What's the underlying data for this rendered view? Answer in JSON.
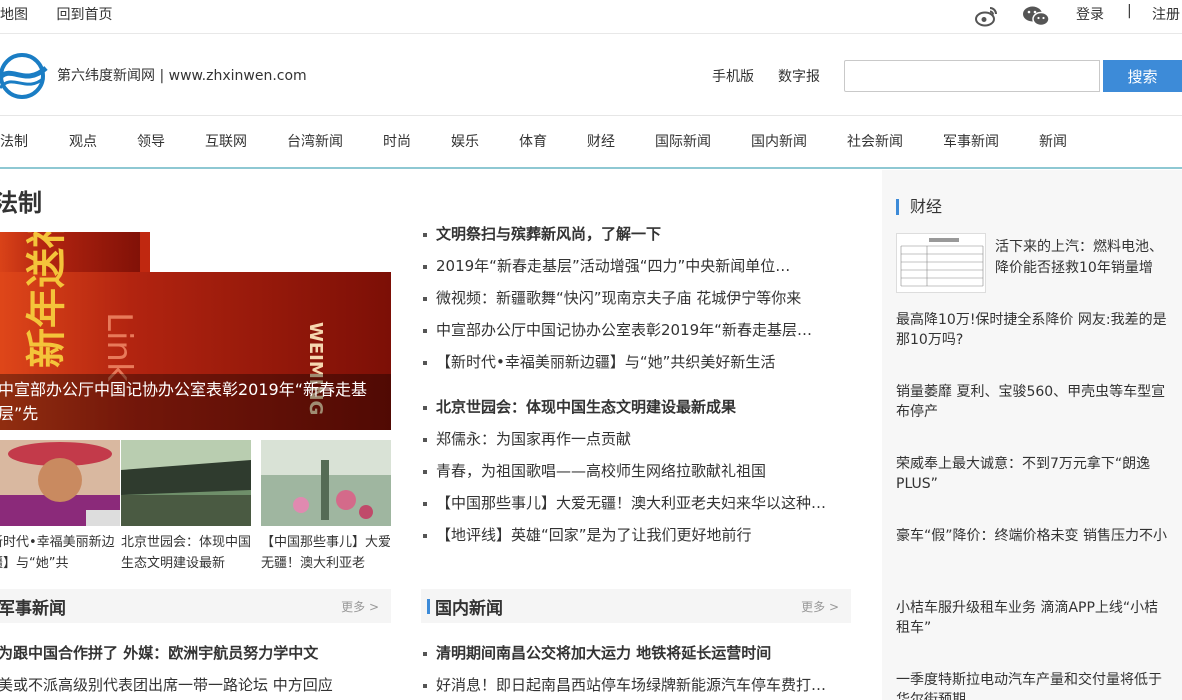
{
  "topbar": {
    "links": [
      "站地图",
      "回到首页"
    ],
    "login": "登录",
    "separator": "|",
    "register": "注册"
  },
  "header": {
    "site_name": "第六纬度新闻网 | www.zhxinwen.com",
    "mobile": "手机版",
    "digital": "数字报",
    "search_placeholder": "",
    "search_button": "搜索"
  },
  "nav": [
    "法制",
    "观点",
    "领导",
    "互联网",
    "台湾新闻",
    "时尚",
    "娱乐",
    "体育",
    "财经",
    "国际新闻",
    "国内新闻",
    "社会新闻",
    "军事新闻",
    "新闻"
  ],
  "section": {
    "title": "法制",
    "hero_caption": "中宣部办公厅中国记协办公室表彰2019年“新春走基层”先",
    "thumbs": [
      "新时代•幸福美丽新边疆】与“她”共",
      "北京世园会：体现中国生态文明建设最新",
      "【中国那些事儿】大爱无疆！澳大利亚老"
    ],
    "list1": [
      {
        "text": "文明祭扫与殡葬新风尚，了解一下",
        "bold": true
      },
      {
        "text": "2019年“新春走基层”活动增强“四力”中央新闻单位…",
        "bold": false
      },
      {
        "text": "微视频：新疆歌舞“快闪”现南京夫子庙 花城伊宁等你来",
        "bold": false
      },
      {
        "text": "中宣部办公厅中国记协办公室表彰2019年“新春走基层…",
        "bold": false
      },
      {
        "text": "【新时代•幸福美丽新边疆】与“她”共织美好新生活",
        "bold": false
      }
    ],
    "list2": [
      {
        "text": "北京世园会：体现中国生态文明建设最新成果",
        "bold": true
      },
      {
        "text": "郑儒永：为国家再作一点贡献",
        "bold": false
      },
      {
        "text": "青春，为祖国歌唱——高校师生网络拉歌献礼祖国",
        "bold": false
      },
      {
        "text": "【中国那些事儿】大爱无疆！澳大利亚老夫妇来华以这种…",
        "bold": false
      },
      {
        "text": "【地评线】英雄“回家”是为了让我们更好地前行",
        "bold": false
      }
    ]
  },
  "military": {
    "title": "军事新闻",
    "more": "更多 >",
    "items": [
      {
        "text": "为跟中国合作拼了 外媒：欧洲宇航员努力学中文",
        "bold": true
      },
      {
        "text": "美或不派高级别代表团出席一带一路论坛 中方回应",
        "bold": false
      }
    ]
  },
  "domestic": {
    "title": "国内新闻",
    "more": "更多 >",
    "items": [
      {
        "text": "清明期间南昌公交将加大运力 地铁将延长运营时间",
        "bold": true
      },
      {
        "text": "好消息！即日起南昌西站停车场绿牌新能源汽车停车费打…",
        "bold": false
      }
    ]
  },
  "finance": {
    "title": "财经",
    "first": "活下来的上汽：燃料电池、降价能否拯救10年销量增",
    "items": [
      "最高降10万!保时捷全系降价 网友:我差的是那10万吗?",
      "销量萎靡 夏利、宝骏560、甲壳虫等车型宣布停产",
      "荣威奉上最大诚意：不到7万元拿下“朗逸PLUS”",
      "豪车“假”降价：终端价格未变 销售压力不小",
      "小桔车服升级租车业务 滴滴APP上线“小桔租车”",
      "一季度特斯拉电动汽车产量和交付量将低于华尔街预期"
    ]
  },
  "hero_image_text": {
    "left": "新年送福",
    "mid": "Link",
    "right": "WEIMING"
  }
}
